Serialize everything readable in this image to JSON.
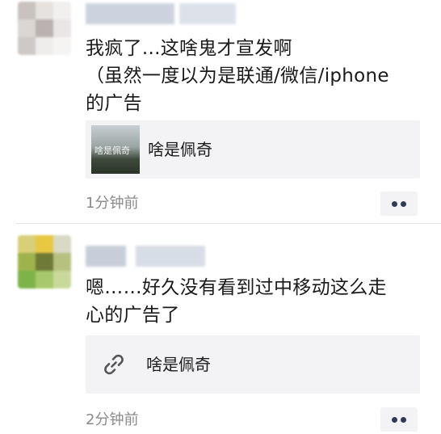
{
  "posts": [
    {
      "text_line1": "我疯了...这啥鬼才宣发啊",
      "text_line2": "（虽然一度以为是联通/微信/iphone",
      "text_line3": "的广告",
      "link_title": "啥是佩奇",
      "link_thumb_caption": "啥是佩奇",
      "link_icon": "thumbnail-image",
      "time": "1分钟前",
      "more_icon": "more-dots-icon"
    },
    {
      "text_line1": "嗯……好久没有看到过中移动这么走",
      "text_line2": "心的广告了",
      "link_title": "啥是佩奇",
      "link_icon": "link-chain-icon",
      "time": "2分钟前",
      "more_icon": "more-dots-icon"
    }
  ],
  "colors": {
    "text": "#1a1a1a",
    "time": "#8a8a8a",
    "card_bg": "#f3f3f5",
    "dots": "#2f3a56"
  }
}
